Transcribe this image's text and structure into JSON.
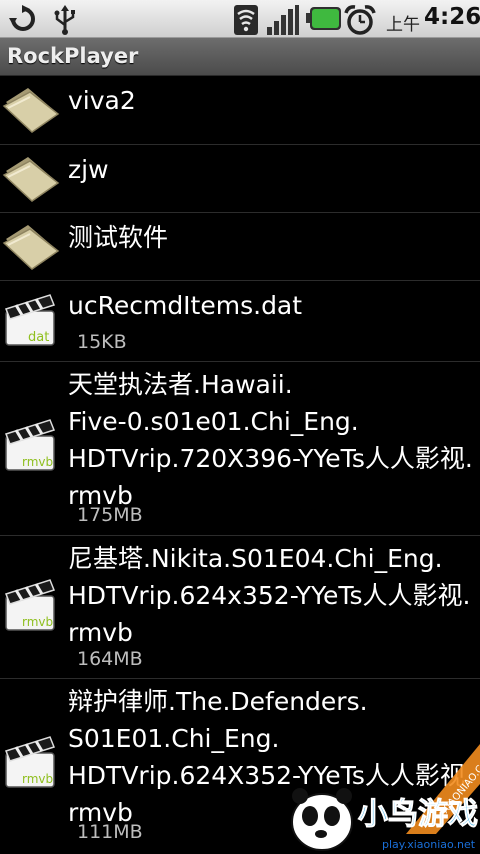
{
  "status_bar": {
    "icons": [
      "sync-icon",
      "usb-icon",
      "wifi-icon",
      "signal-icon",
      "battery-icon",
      "alarm-icon"
    ],
    "time_prefix": "上午",
    "time": "4:26"
  },
  "app": {
    "title": "RockPlayer"
  },
  "files": [
    {
      "name": "viva2",
      "type": "folder"
    },
    {
      "name": "zjw",
      "type": "folder"
    },
    {
      "name": "测试软件",
      "type": "folder"
    },
    {
      "name": "ucRecmdItems.dat",
      "size": "15KB",
      "badge": "dat",
      "type": "file"
    },
    {
      "lines": [
        "天堂执法者.Hawaii.",
        "Five-0.s01e01.Chi_Eng.",
        "HDTVrip.720X396-YYeTs人人影视.",
        "rmvb"
      ],
      "size": "175MB",
      "badge": "rmvb",
      "type": "file"
    },
    {
      "lines": [
        "尼基塔.Nikita.S01E04.Chi_Eng.",
        "HDTVrip.624x352-YYeTs人人影视.",
        "rmvb"
      ],
      "size": "164MB",
      "badge": "rmvb",
      "type": "file"
    },
    {
      "lines": [
        "辩护律师.The.Defenders.",
        "S01E01.Chi_Eng.",
        "HDTVrip.624X352-YYeTs人人影视.",
        "rmvb"
      ],
      "size": "111MB",
      "badge": "rmvb",
      "type": "file"
    }
  ],
  "watermark": {
    "logo_text": "小鸟游戏",
    "url_text": "XIAONIAO.COM",
    "url_text_2": "play.xiaoniao.net"
  },
  "colors": {
    "status_bar_bg": "#dcdcdc",
    "title_bar_bg": "#5a5a5a",
    "list_bg": "#000000",
    "badge_green": "#8fbf1f",
    "battery_green": "#3fb93f"
  }
}
